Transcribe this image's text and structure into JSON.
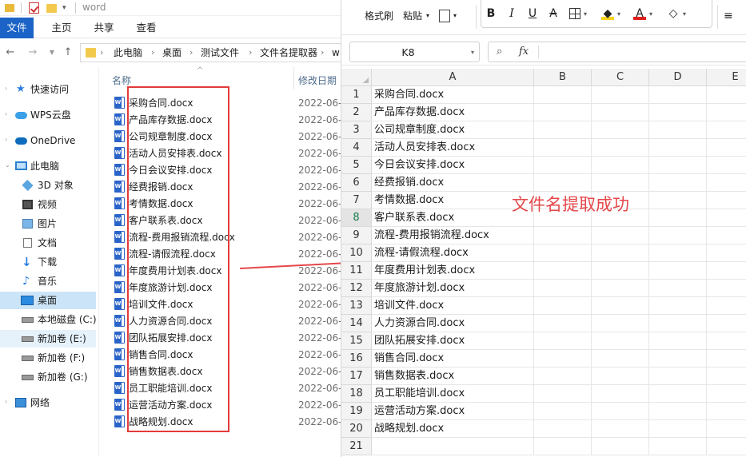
{
  "explorer": {
    "title": "word",
    "ribbon_tabs": [
      "文件",
      "主页",
      "共享",
      "查看"
    ],
    "breadcrumb": [
      "此电脑",
      "桌面",
      "测试文件",
      "文件名提取器",
      "w"
    ],
    "nav_items": [
      {
        "label": "快速访问",
        "icon": "star-icon"
      },
      {
        "label": "WPS云盘",
        "icon": "cloud-icon"
      },
      {
        "label": "OneDrive",
        "icon": "onedrive-cloud-icon"
      },
      {
        "label": "此电脑",
        "icon": "computer-icon"
      },
      {
        "label": "3D 对象",
        "icon": "cube-icon"
      },
      {
        "label": "视频",
        "icon": "video-icon"
      },
      {
        "label": "图片",
        "icon": "picture-icon"
      },
      {
        "label": "文档",
        "icon": "document-icon"
      },
      {
        "label": "下载",
        "icon": "download-icon"
      },
      {
        "label": "音乐",
        "icon": "music-icon"
      },
      {
        "label": "桌面",
        "icon": "desktop-icon"
      },
      {
        "label": "本地磁盘 (C:)",
        "icon": "drive-icon"
      },
      {
        "label": "新加卷 (E:)",
        "icon": "drive-icon"
      },
      {
        "label": "新加卷 (F:)",
        "icon": "drive-icon"
      },
      {
        "label": "新加卷 (G:)",
        "icon": "drive-icon"
      },
      {
        "label": "网络",
        "icon": "network-icon"
      }
    ],
    "columns": {
      "name": "名称",
      "date": "修改日期"
    },
    "files": [
      {
        "name": "采购合同.docx",
        "date": "2022-06-"
      },
      {
        "name": "产品库存数据.docx",
        "date": "2022-06-"
      },
      {
        "name": "公司规章制度.docx",
        "date": "2022-06-"
      },
      {
        "name": "活动人员安排表.docx",
        "date": "2022-06-"
      },
      {
        "name": "今日会议安排.docx",
        "date": "2022-06-"
      },
      {
        "name": "经费报销.docx",
        "date": "2022-06-"
      },
      {
        "name": "考情数据.docx",
        "date": "2022-06-"
      },
      {
        "name": "客户联系表.docx",
        "date": "2022-06-"
      },
      {
        "name": "流程-费用报销流程.docx",
        "date": "2022-06-"
      },
      {
        "name": "流程-请假流程.docx",
        "date": "2022-06-"
      },
      {
        "name": "年度费用计划表.docx",
        "date": "2022-06-"
      },
      {
        "name": "年度旅游计划.docx",
        "date": "2022-06-"
      },
      {
        "name": "培训文件.docx",
        "date": "2022-06-"
      },
      {
        "name": "人力资源合同.docx",
        "date": "2022-06-"
      },
      {
        "name": "团队拓展安排.docx",
        "date": "2022-06-"
      },
      {
        "name": "销售合同.docx",
        "date": "2022-06-"
      },
      {
        "name": "销售数据表.docx",
        "date": "2022-06-"
      },
      {
        "name": "员工职能培训.docx",
        "date": "2022-06-"
      },
      {
        "name": "运营活动方案.docx",
        "date": "2022-06-"
      },
      {
        "name": "战略规划.docx",
        "date": "2022-06-"
      }
    ]
  },
  "toolbar": {
    "format_painter": "格式刷",
    "paste": "粘贴"
  },
  "formula_bar": {
    "name_box": "K8",
    "formula": ""
  },
  "sheet": {
    "columns": [
      "A",
      "B",
      "C",
      "D",
      "E"
    ],
    "rows": [
      "1",
      "2",
      "3",
      "4",
      "5",
      "6",
      "7",
      "8",
      "9",
      "10",
      "11",
      "12",
      "13",
      "14",
      "15",
      "16",
      "17",
      "18",
      "19",
      "20",
      "21"
    ],
    "active_row": 8,
    "column_a": [
      "采购合同.docx",
      "产品库存数据.docx",
      "公司规章制度.docx",
      "活动人员安排表.docx",
      "今日会议安排.docx",
      "经费报销.docx",
      "考情数据.docx",
      "客户联系表.docx",
      "流程-费用报销流程.docx",
      "流程-请假流程.docx",
      "年度费用计划表.docx",
      "年度旅游计划.docx",
      "培训文件.docx",
      "人力资源合同.docx",
      "团队拓展安排.docx",
      "销售合同.docx",
      "销售数据表.docx",
      "员工职能培训.docx",
      "运营活动方案.docx",
      "战略规划.docx",
      ""
    ]
  },
  "annotation": {
    "text": "文件名提取成功",
    "color": "#e5474a"
  }
}
